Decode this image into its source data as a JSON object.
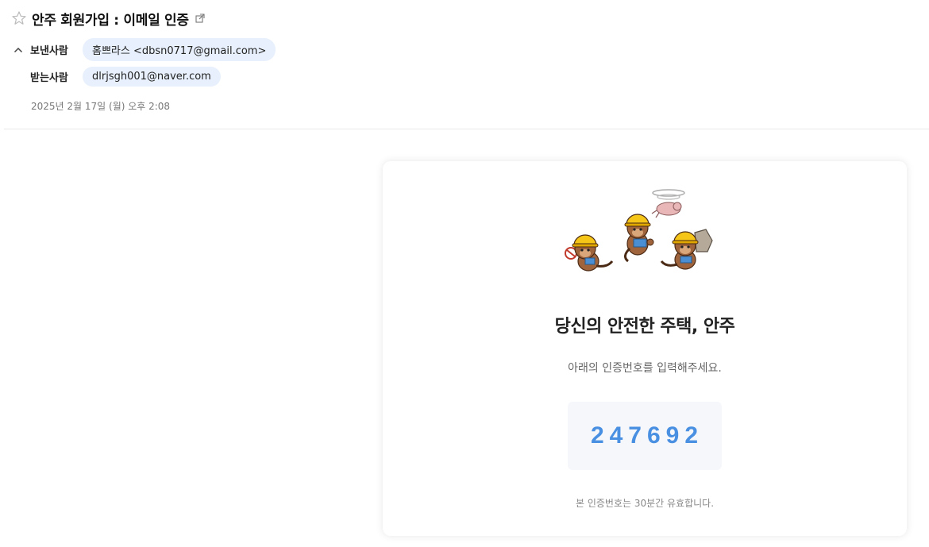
{
  "email": {
    "subject": "안주 회원가입 : 이메일 인증",
    "sender_label": "보낸사람",
    "sender": "홈쁘라스 <dbsn0717@gmail.com>",
    "receiver_label": "받는사람",
    "receiver": "dlrjsgh001@naver.com",
    "date": "2025년 2월 17일 (월) 오후 2:08"
  },
  "body": {
    "title": "당신의 안전한 주택, 안주",
    "description": "아래의 인증번호를 입력해주세요.",
    "code": "247692",
    "note": "본 인증번호는 30분간 유효합니다."
  },
  "colors": {
    "code": "#4a90e2",
    "chip_bg": "#e7f0fc",
    "code_box_bg": "#f5f7fa",
    "helmet": "#f5c518",
    "otter": "#a0643c"
  },
  "icons": {
    "star": "star-icon",
    "external": "external-link-icon",
    "collapse": "chevron-up-icon"
  }
}
